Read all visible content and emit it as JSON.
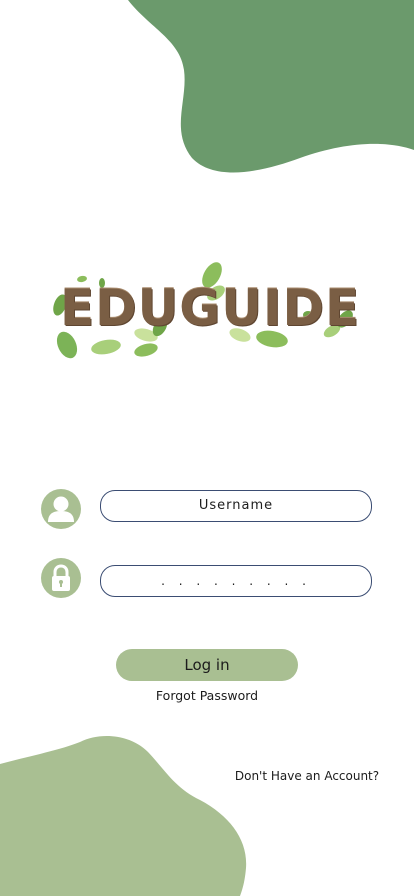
{
  "colors": {
    "dark_green": "#6b9a6c",
    "light_green": "#a9bf92",
    "logo_brown": "#7a5e44",
    "field_border": "#3b4d73"
  },
  "logo": {
    "text": "EDUGUIDE"
  },
  "form": {
    "username": {
      "placeholder": "Username",
      "icon": "user-icon"
    },
    "password": {
      "value": ". . . . . . . . .",
      "icon": "lock-icon"
    },
    "login_label": "Log in",
    "forgot_label": "Forgot Password"
  },
  "footer": {
    "signup_label": "Don't Have an Account?"
  }
}
